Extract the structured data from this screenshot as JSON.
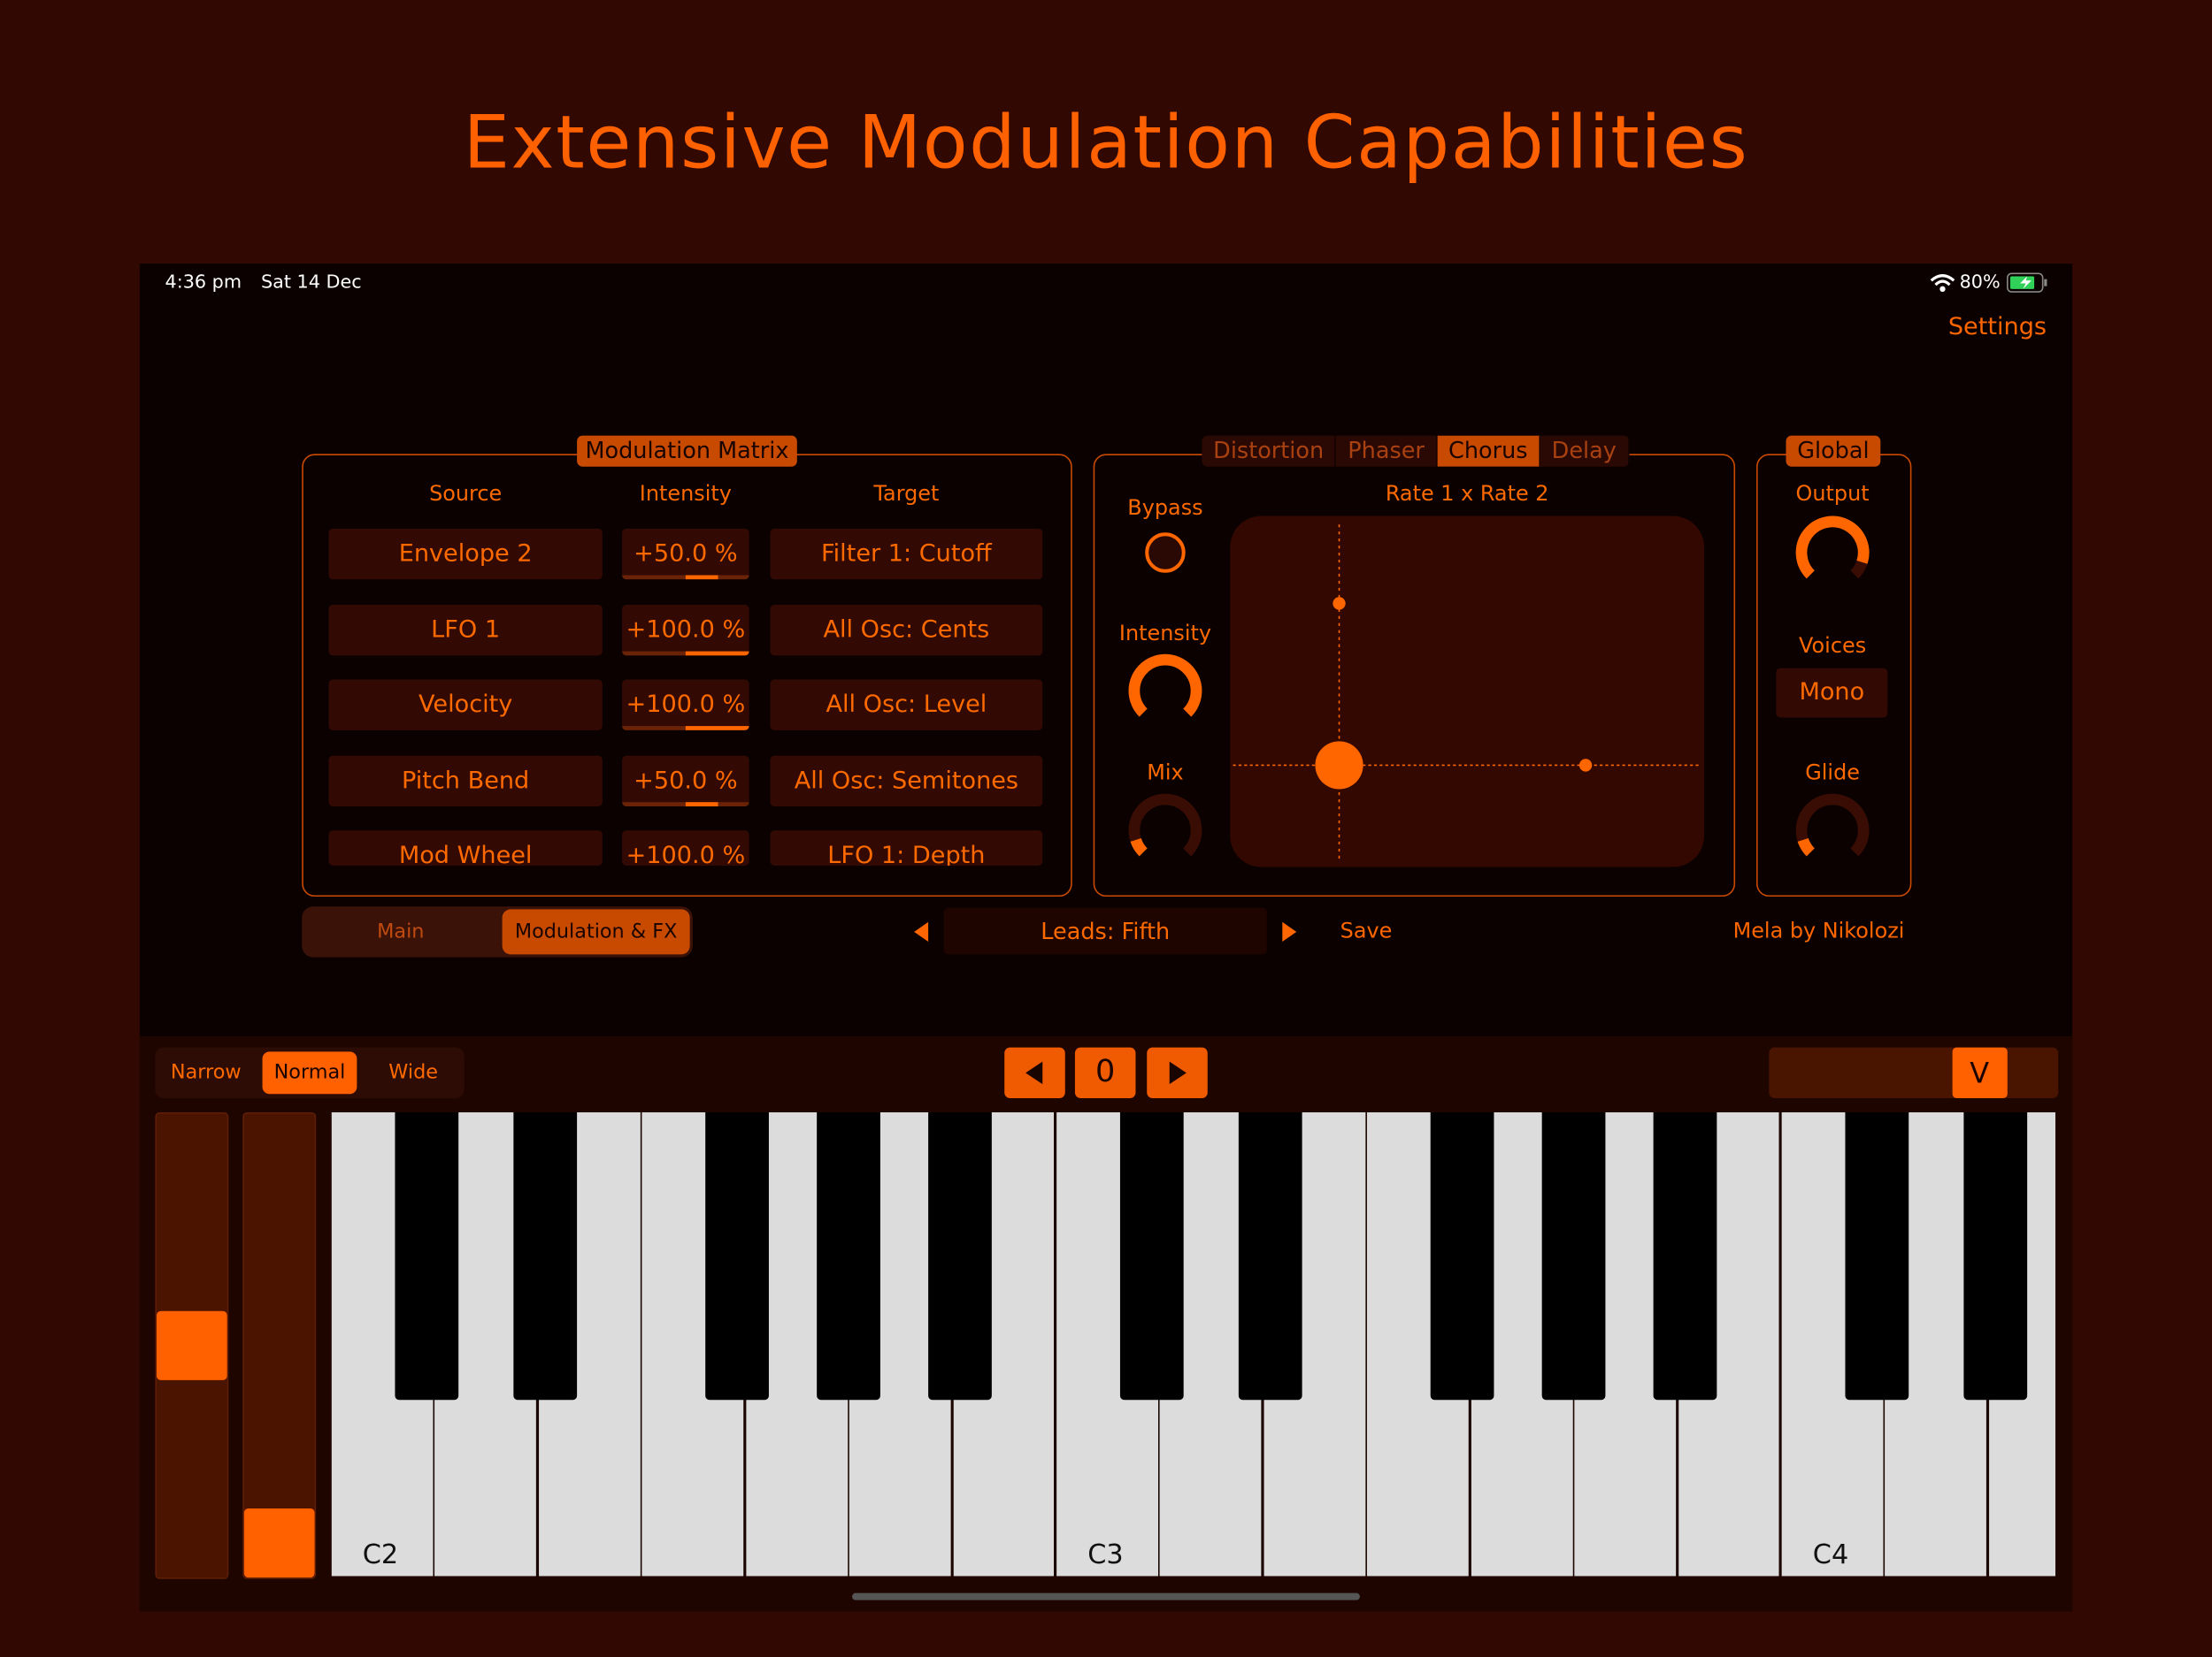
{
  "headline": "Extensive Modulation Capabilities",
  "status_bar": {
    "time": "4:36 pm",
    "date": "Sat 14 Dec",
    "battery": "80%",
    "wifi_icon": "wifi-icon",
    "battery_icon": "battery-charging-icon"
  },
  "settings_label": "Settings",
  "colors": {
    "accent": "#ff6600",
    "tab_active": "#c84a00",
    "cell_bg": "#330a03",
    "screen_bg": "#0b0100",
    "page_bg": "#320803"
  },
  "mod_matrix": {
    "title": "Modulation Matrix",
    "headers": {
      "source": "Source",
      "intensity": "Intensity",
      "target": "Target"
    },
    "rows": [
      {
        "source": "Envelope 2",
        "intensity": "+50.0 %",
        "intensity_value": 50,
        "target": "Filter 1: Cutoff"
      },
      {
        "source": "LFO 1",
        "intensity": "+100.0 %",
        "intensity_value": 100,
        "target": "All Osc: Cents"
      },
      {
        "source": "Velocity",
        "intensity": "+100.0 %",
        "intensity_value": 100,
        "target": "All Osc: Level"
      },
      {
        "source": "Pitch Bend",
        "intensity": "+50.0 %",
        "intensity_value": 50,
        "target": "All Osc: Semitones"
      },
      {
        "source": "Mod Wheel",
        "intensity": "+100.0 %",
        "intensity_value": 100,
        "target": "LFO 1: Depth"
      }
    ]
  },
  "fx": {
    "tabs": [
      {
        "label": "Distortion",
        "active": false
      },
      {
        "label": "Phaser",
        "active": false
      },
      {
        "label": "Chorus",
        "active": true
      },
      {
        "label": "Delay",
        "active": false
      }
    ],
    "bypass_label": "Bypass",
    "bypass_on": false,
    "intensity_label": "Intensity",
    "intensity_value": 1.0,
    "mix_label": "Mix",
    "mix_value": 0.1,
    "pad_title": "Rate 1  x  Rate 2",
    "pad_x": 0.23,
    "pad_y": 0.29
  },
  "global": {
    "title": "Global",
    "output_label": "Output",
    "output_value": 0.9,
    "voices_label": "Voices",
    "voices_value": "Mono",
    "glide_label": "Glide",
    "glide_value": 0.1
  },
  "bottom_bar": {
    "views": [
      {
        "label": "Main",
        "active": false
      },
      {
        "label": "Modulation & FX",
        "active": true
      }
    ],
    "preset": "Leads: Fifth",
    "save_label": "Save",
    "credit": "Mela by Nikolozi"
  },
  "keyboard": {
    "widths": [
      {
        "label": "Narrow",
        "active": false
      },
      {
        "label": "Normal",
        "active": true
      },
      {
        "label": "Wide",
        "active": false
      }
    ],
    "octave_value": "0",
    "velocity_label": "V",
    "velocity_value": 0.73,
    "pitch_wheel": 0.5,
    "mod_wheel": 0.0,
    "octave_labels": [
      "C2",
      "C3",
      "C4"
    ]
  }
}
